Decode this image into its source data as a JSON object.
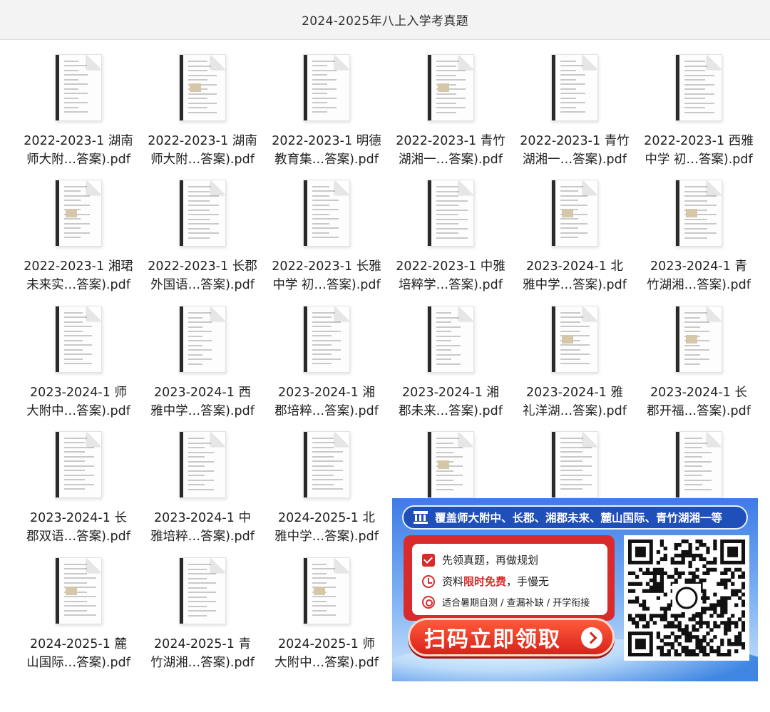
{
  "window": {
    "title": "2024-2025年八上入学考真题"
  },
  "files": [
    {
      "line1": "2022-2023-1 湖南",
      "line2": "师大附…答案).pdf"
    },
    {
      "line1": "2022-2023-1 湖南",
      "line2": "师大附…答案).pdf"
    },
    {
      "line1": "2022-2023-1 明德",
      "line2": "教育集…答案).pdf"
    },
    {
      "line1": "2022-2023-1 青竹",
      "line2": "湖湘一…答案).pdf"
    },
    {
      "line1": "2022-2023-1 青竹",
      "line2": "湖湘一…答案).pdf"
    },
    {
      "line1": "2022-2023-1 西雅",
      "line2": "中学 初…答案).pdf"
    },
    {
      "line1": "2022-2023-1 湘珺",
      "line2": "未来实…答案).pdf"
    },
    {
      "line1": "2022-2023-1 长郡",
      "line2": "外国语…答案).pdf"
    },
    {
      "line1": "2022-2023-1 长雅",
      "line2": "中学 初…答案).pdf"
    },
    {
      "line1": "2022-2023-1 中雅",
      "line2": "培粹学…答案).pdf"
    },
    {
      "line1": "2023-2024-1 北",
      "line2": "雅中学…答案).pdf"
    },
    {
      "line1": "2023-2024-1 青",
      "line2": "竹湖湘…答案).pdf"
    },
    {
      "line1": "2023-2024-1 师",
      "line2": "大附中…答案).pdf"
    },
    {
      "line1": "2023-2024-1 西",
      "line2": "雅中学…答案).pdf"
    },
    {
      "line1": "2023-2024-1 湘",
      "line2": "郡培粹…答案).pdf"
    },
    {
      "line1": "2023-2024-1 湘",
      "line2": "郡未来…答案).pdf"
    },
    {
      "line1": "2023-2024-1 雅",
      "line2": "礼洋湖…答案).pdf"
    },
    {
      "line1": "2023-2024-1 长",
      "line2": "郡开福…答案).pdf"
    },
    {
      "line1": "2023-2024-1 长",
      "line2": "郡双语…答案).pdf"
    },
    {
      "line1": "2023-2024-1 中",
      "line2": "雅培粹…答案).pdf"
    },
    {
      "line1": "2024-2025-1 北",
      "line2": "雅中学…答案).pdf"
    },
    {
      "line1": "",
      "line2": ""
    },
    {
      "line1": "",
      "line2": ""
    },
    {
      "line1": "",
      "line2": ""
    },
    {
      "line1": "2024-2025-1 麓",
      "line2": "山国际…答案).pdf"
    },
    {
      "line1": "2024-2025-1 青",
      "line2": "竹湖湘…答案).pdf"
    },
    {
      "line1": "2024-2025-1 师",
      "line2": "大附中…答案).pdf"
    }
  ],
  "ad": {
    "banner": "覆盖师大附中、长郡、湘郡未来、麓山国际、青竹湖湘一等",
    "item1": "先领真题，再做规划",
    "item2_pre": "资料",
    "item2_red": "限时免费",
    "item2_post": "，手慢无",
    "item3": "适合暑期自测 / 查漏补缺 / 开学衔接",
    "cta": "扫码立即领取",
    "colors": {
      "red": "#d92b2b",
      "blue": "#1f4fb8"
    }
  }
}
